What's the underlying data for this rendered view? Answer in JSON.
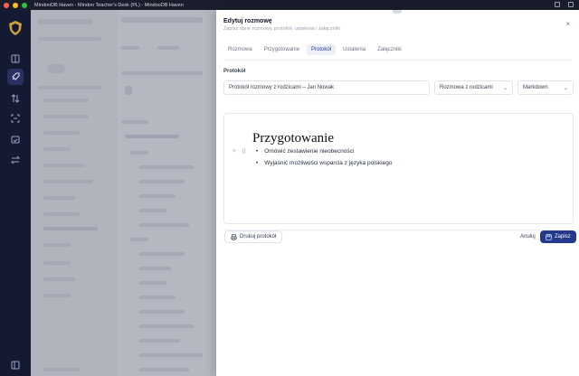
{
  "window": {
    "title": "MindooDB Haven - Mindoo Teacher's Desk (PL) - MindooDB Haven"
  },
  "rail": {
    "items": [
      "dashboard-icon",
      "rocket-icon",
      "transfer-icon",
      "scan-icon",
      "calendar-check-icon",
      "swap-icon"
    ],
    "bottom": "panel-icon"
  },
  "drawer": {
    "title": "Edytuj rozmowę",
    "subtitle": "Zapisz dane rozmowy, protokół, ustalenia i załączniki",
    "close": "×",
    "tabs": [
      {
        "label": "Rozmowa"
      },
      {
        "label": "Przygotowanie"
      },
      {
        "label": "Protokół"
      },
      {
        "label": "Ustalenia"
      },
      {
        "label": "Załączniki"
      }
    ],
    "active_tab": "Protokół",
    "section_label": "Protokół",
    "protocol_title": "Protokół rozmowy z rodzicami – Jan Nowak",
    "type_select": "Rozmowa z rodzicami",
    "format_select": "Markdown",
    "editor": {
      "heading": "Przygotowanie",
      "bullets": [
        "Omówić zestawienie nieobecności",
        "Wyjaśnić możliwości wsparcia z języka polskiego"
      ]
    },
    "actions": {
      "print": "Drukuj protokół",
      "cancel": "Anuluj",
      "save": "Zapisz"
    }
  },
  "colors": {
    "accent": "#243a8f",
    "rail": "#151a33"
  }
}
